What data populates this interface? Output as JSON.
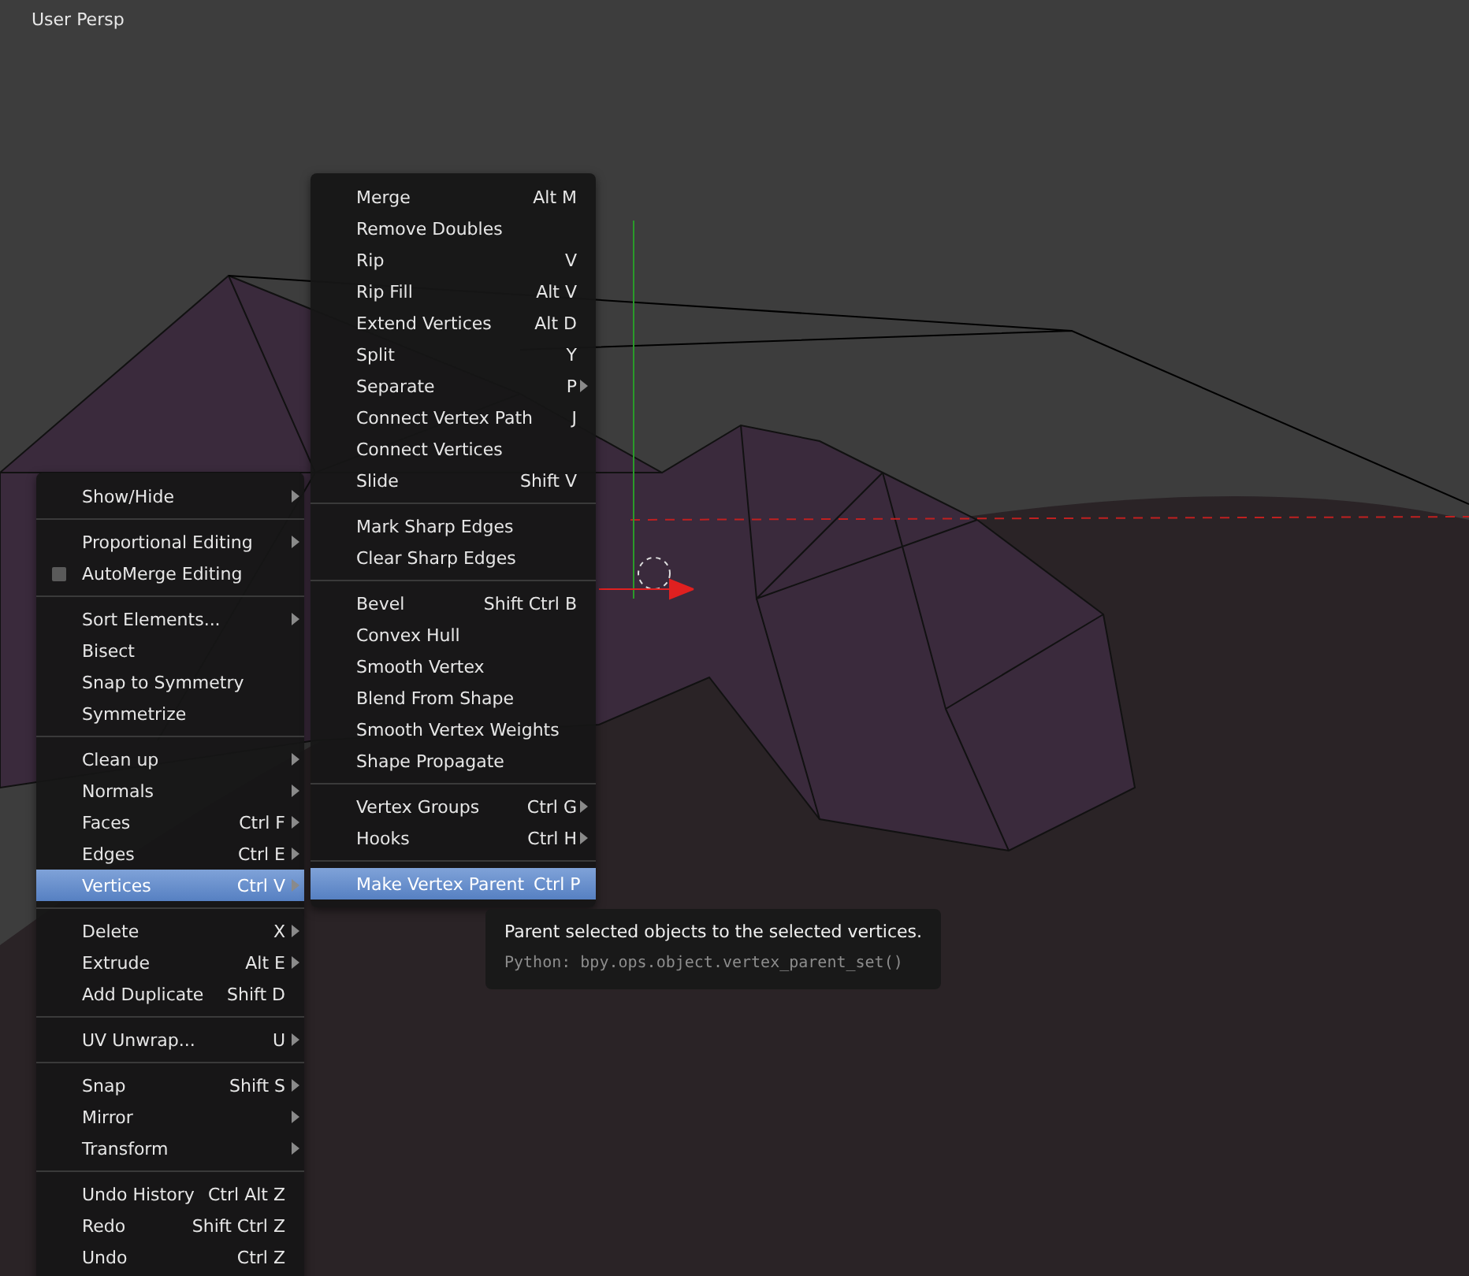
{
  "viewport": {
    "title": "User Persp"
  },
  "mesh_menu": {
    "sections": [
      [
        {
          "label": "Show/Hide",
          "submenu": true,
          "selected": false,
          "kind": "item"
        }
      ],
      [
        {
          "label": "Proportional Editing",
          "submenu": true,
          "selected": false,
          "kind": "item"
        },
        {
          "label": "AutoMerge Editing",
          "submenu": false,
          "selected": false,
          "kind": "checkbox",
          "checked": false
        }
      ],
      [
        {
          "label": "Sort Elements...",
          "submenu": true,
          "selected": false,
          "kind": "item"
        },
        {
          "label": "Bisect",
          "submenu": false,
          "selected": false,
          "kind": "item"
        },
        {
          "label": "Snap to Symmetry",
          "submenu": false,
          "selected": false,
          "kind": "item"
        },
        {
          "label": "Symmetrize",
          "submenu": false,
          "selected": false,
          "kind": "item"
        }
      ],
      [
        {
          "label": "Clean up",
          "submenu": true,
          "selected": false,
          "kind": "item"
        },
        {
          "label": "Normals",
          "submenu": true,
          "selected": false,
          "kind": "item"
        },
        {
          "label": "Faces",
          "shortcut": "Ctrl F",
          "submenu": true,
          "selected": false,
          "kind": "item"
        },
        {
          "label": "Edges",
          "shortcut": "Ctrl E",
          "submenu": true,
          "selected": false,
          "kind": "item"
        },
        {
          "label": "Vertices",
          "shortcut": "Ctrl V",
          "submenu": true,
          "selected": true,
          "kind": "item"
        }
      ],
      [
        {
          "label": "Delete",
          "shortcut": "X",
          "submenu": true,
          "selected": false,
          "kind": "item"
        },
        {
          "label": "Extrude",
          "shortcut": "Alt E",
          "submenu": true,
          "selected": false,
          "kind": "item"
        },
        {
          "label": "Add Duplicate",
          "shortcut": "Shift D",
          "submenu": false,
          "selected": false,
          "kind": "item"
        }
      ],
      [
        {
          "label": "UV Unwrap...",
          "shortcut": "U",
          "submenu": true,
          "selected": false,
          "kind": "item"
        }
      ],
      [
        {
          "label": "Snap",
          "shortcut": "Shift S",
          "submenu": true,
          "selected": false,
          "kind": "item"
        },
        {
          "label": "Mirror",
          "submenu": true,
          "selected": false,
          "kind": "item"
        },
        {
          "label": "Transform",
          "submenu": true,
          "selected": false,
          "kind": "item"
        }
      ],
      [
        {
          "label": "Undo History",
          "shortcut": "Ctrl Alt Z",
          "submenu": false,
          "selected": false,
          "kind": "item"
        },
        {
          "label": "Redo",
          "shortcut": "Shift Ctrl Z",
          "submenu": false,
          "selected": false,
          "kind": "item"
        },
        {
          "label": "Undo",
          "shortcut": "Ctrl Z",
          "submenu": false,
          "selected": false,
          "kind": "item"
        }
      ]
    ]
  },
  "vertices_menu": {
    "sections": [
      [
        {
          "label": "Merge",
          "shortcut": "Alt M",
          "submenu": false,
          "selected": false,
          "kind": "item"
        },
        {
          "label": "Remove Doubles",
          "submenu": false,
          "selected": false,
          "kind": "item"
        },
        {
          "label": "Rip",
          "shortcut": "V",
          "submenu": false,
          "selected": false,
          "kind": "item"
        },
        {
          "label": "Rip Fill",
          "shortcut": "Alt V",
          "submenu": false,
          "selected": false,
          "kind": "item"
        },
        {
          "label": "Extend Vertices",
          "shortcut": "Alt D",
          "submenu": false,
          "selected": false,
          "kind": "item"
        },
        {
          "label": "Split",
          "shortcut": "Y",
          "submenu": false,
          "selected": false,
          "kind": "item"
        },
        {
          "label": "Separate",
          "shortcut": "P",
          "submenu": true,
          "selected": false,
          "kind": "item"
        },
        {
          "label": "Connect Vertex Path",
          "shortcut": "J",
          "submenu": false,
          "selected": false,
          "kind": "item"
        },
        {
          "label": "Connect Vertices",
          "submenu": false,
          "selected": false,
          "kind": "item"
        },
        {
          "label": "Slide",
          "shortcut": "Shift V",
          "submenu": false,
          "selected": false,
          "kind": "item"
        }
      ],
      [
        {
          "label": "Mark Sharp Edges",
          "submenu": false,
          "selected": false,
          "kind": "item"
        },
        {
          "label": "Clear Sharp Edges",
          "submenu": false,
          "selected": false,
          "kind": "item"
        }
      ],
      [
        {
          "label": "Bevel",
          "shortcut": "Shift Ctrl B",
          "submenu": false,
          "selected": false,
          "kind": "item"
        },
        {
          "label": "Convex Hull",
          "submenu": false,
          "selected": false,
          "kind": "item"
        },
        {
          "label": "Smooth Vertex",
          "submenu": false,
          "selected": false,
          "kind": "item"
        },
        {
          "label": "Blend From Shape",
          "submenu": false,
          "selected": false,
          "kind": "item"
        },
        {
          "label": "Smooth Vertex Weights",
          "submenu": false,
          "selected": false,
          "kind": "item"
        },
        {
          "label": "Shape Propagate",
          "submenu": false,
          "selected": false,
          "kind": "item"
        }
      ],
      [
        {
          "label": "Vertex Groups",
          "shortcut": "Ctrl G",
          "submenu": true,
          "selected": false,
          "kind": "item"
        },
        {
          "label": "Hooks",
          "shortcut": "Ctrl H",
          "submenu": true,
          "selected": false,
          "kind": "item"
        }
      ],
      [
        {
          "label": "Make Vertex Parent",
          "shortcut": "Ctrl P",
          "submenu": false,
          "selected": true,
          "kind": "item"
        }
      ]
    ]
  },
  "tooltip": {
    "description": "Parent selected objects to the selected vertices.",
    "python": "Python: bpy.ops.object.vertex_parent_set()"
  }
}
